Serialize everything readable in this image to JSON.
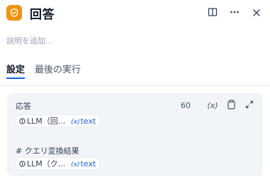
{
  "header": {
    "title": "回答"
  },
  "description": {
    "placeholder": "説明を追加..."
  },
  "tabs": [
    {
      "label": "設定",
      "active": true
    },
    {
      "label": "最後の実行",
      "active": false
    }
  ],
  "output": {
    "label": "応答",
    "char_count": "60",
    "variable_button_label": "(x)",
    "chips": [
      {
        "node": "LLM（回...",
        "var_prefix": "(x)",
        "var": "text"
      }
    ],
    "second_label": "# クエリ変換結果",
    "second_chips": [
      {
        "node": "LLM（ク...",
        "var_prefix": "(x)",
        "var": "text"
      }
    ]
  },
  "colors": {
    "accent": "#155eef",
    "app_icon": "#f79009",
    "card_bg": "#f2f4f7"
  },
  "icons": {
    "app": "answer-shield-icon",
    "book": "book-icon",
    "more": "more-dots-icon",
    "close": "close-icon",
    "variable": "variable-insert-icon",
    "clipboard": "clipboard-icon",
    "expand": "expand-icon",
    "llm": "llm-node-icon"
  }
}
